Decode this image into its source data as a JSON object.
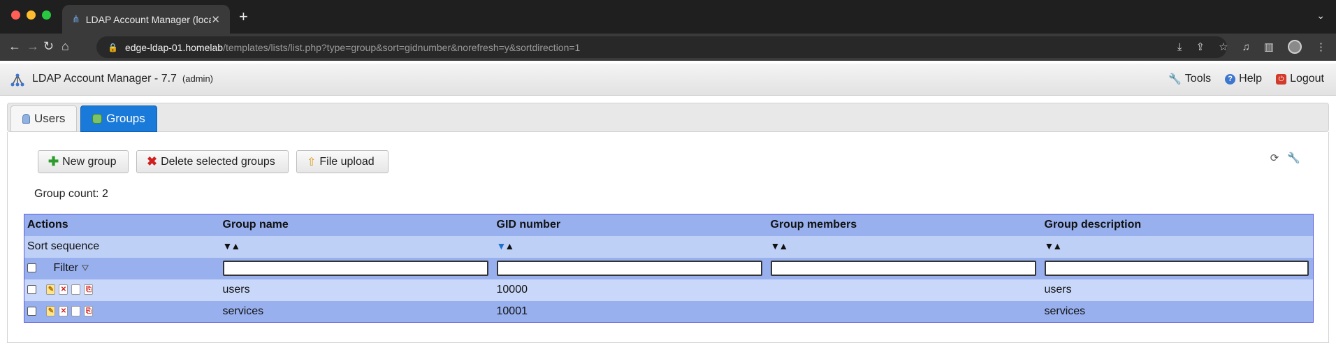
{
  "browser": {
    "tab_title": "LDAP Account Manager (locall",
    "tab_close": "✕",
    "new_tab": "+",
    "url_host": "edge-ldap-01.homelab",
    "url_path": "/templates/lists/list.php?type=group&sort=gidnumber&norefresh=y&sortdirection=1"
  },
  "header": {
    "title": "LDAP Account Manager - 7.7",
    "user": "(admin)",
    "tools": "Tools",
    "help": "Help",
    "logout": "Logout"
  },
  "tabs": [
    {
      "label": "Users",
      "icon": "user-icon",
      "active": false
    },
    {
      "label": "Groups",
      "icon": "group-icon",
      "active": true
    }
  ],
  "buttons": {
    "new_group": "New group",
    "delete_selected": "Delete selected groups",
    "file_upload": "File upload"
  },
  "group_count": "Group count: 2",
  "table": {
    "columns": [
      "Actions",
      "Group name",
      "GID number",
      "Group members",
      "Group description"
    ],
    "sort_label": "Sort sequence",
    "filter_label": "Filter",
    "active_sort_column": "GID number",
    "rows": [
      {
        "name": "users",
        "gid": "10000",
        "members": "",
        "description": "users"
      },
      {
        "name": "services",
        "gid": "10001",
        "members": "",
        "description": "services"
      }
    ]
  },
  "colors": {
    "accent_tab": "#1a7ad9",
    "table_header": "#98b0ee",
    "table_row_light": "#c9d8fa"
  }
}
